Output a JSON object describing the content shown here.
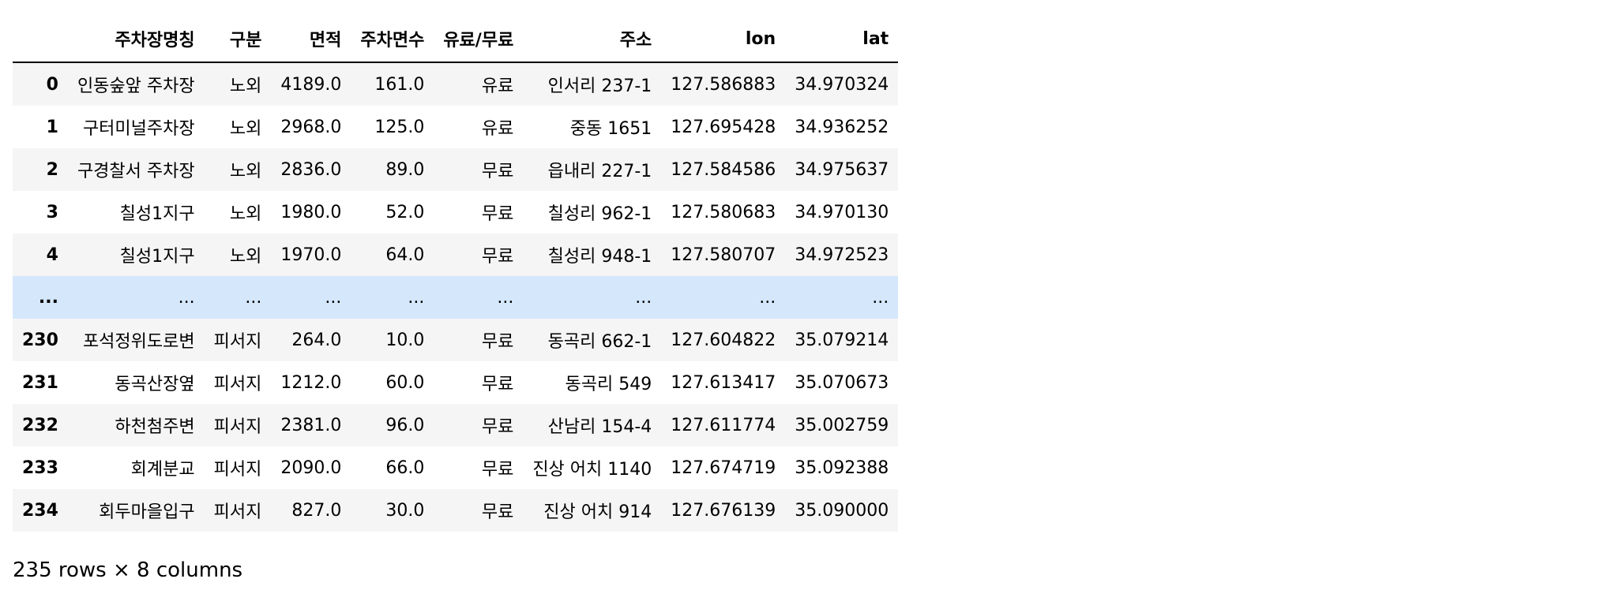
{
  "table": {
    "columns": [
      "",
      "주차장명칭",
      "구분",
      "면적",
      "주차면수",
      "유료/무료",
      "주소",
      "lon",
      "lat"
    ],
    "rows": [
      [
        "0",
        "인동숲앞 주차장",
        "노외",
        "4189.0",
        "161.0",
        "유료",
        "인서리 237-1",
        "127.586883",
        "34.970324"
      ],
      [
        "1",
        "구터미널주차장",
        "노외",
        "2968.0",
        "125.0",
        "유료",
        "중동 1651",
        "127.695428",
        "34.936252"
      ],
      [
        "2",
        "구경찰서 주차장",
        "노외",
        "2836.0",
        "89.0",
        "무료",
        "읍내리 227-1",
        "127.584586",
        "34.975637"
      ],
      [
        "3",
        "칠성1지구",
        "노외",
        "1980.0",
        "52.0",
        "무료",
        "칠성리 962-1",
        "127.580683",
        "34.970130"
      ],
      [
        "4",
        "칠성1지구",
        "노외",
        "1970.0",
        "64.0",
        "무료",
        "칠성리 948-1",
        "127.580707",
        "34.972523"
      ],
      [
        "...",
        "...",
        "...",
        "...",
        "...",
        "...",
        "...",
        "...",
        "..."
      ],
      [
        "230",
        "포석정위도로변",
        "피서지",
        "264.0",
        "10.0",
        "무료",
        "동곡리 662-1",
        "127.604822",
        "35.079214"
      ],
      [
        "231",
        "동곡산장옆",
        "피서지",
        "1212.0",
        "60.0",
        "무료",
        "동곡리 549",
        "127.613417",
        "35.070673"
      ],
      [
        "232",
        "하천첨주변",
        "피서지",
        "2381.0",
        "96.0",
        "무료",
        "산남리 154-4",
        "127.611774",
        "35.002759"
      ],
      [
        "233",
        "회계분교",
        "피서지",
        "2090.0",
        "66.0",
        "무료",
        "진상 어치 1140",
        "127.674719",
        "35.092388"
      ],
      [
        "234",
        "회두마을입구",
        "피서지",
        "827.0",
        "30.0",
        "무료",
        "진상 어치 914",
        "127.676139",
        "35.090000"
      ]
    ]
  },
  "caption": "235 rows × 8 columns",
  "colors": {
    "row_odd": "#f5f5f5",
    "row_even": "#ffffff",
    "row_highlight": "#d5e7fb"
  }
}
